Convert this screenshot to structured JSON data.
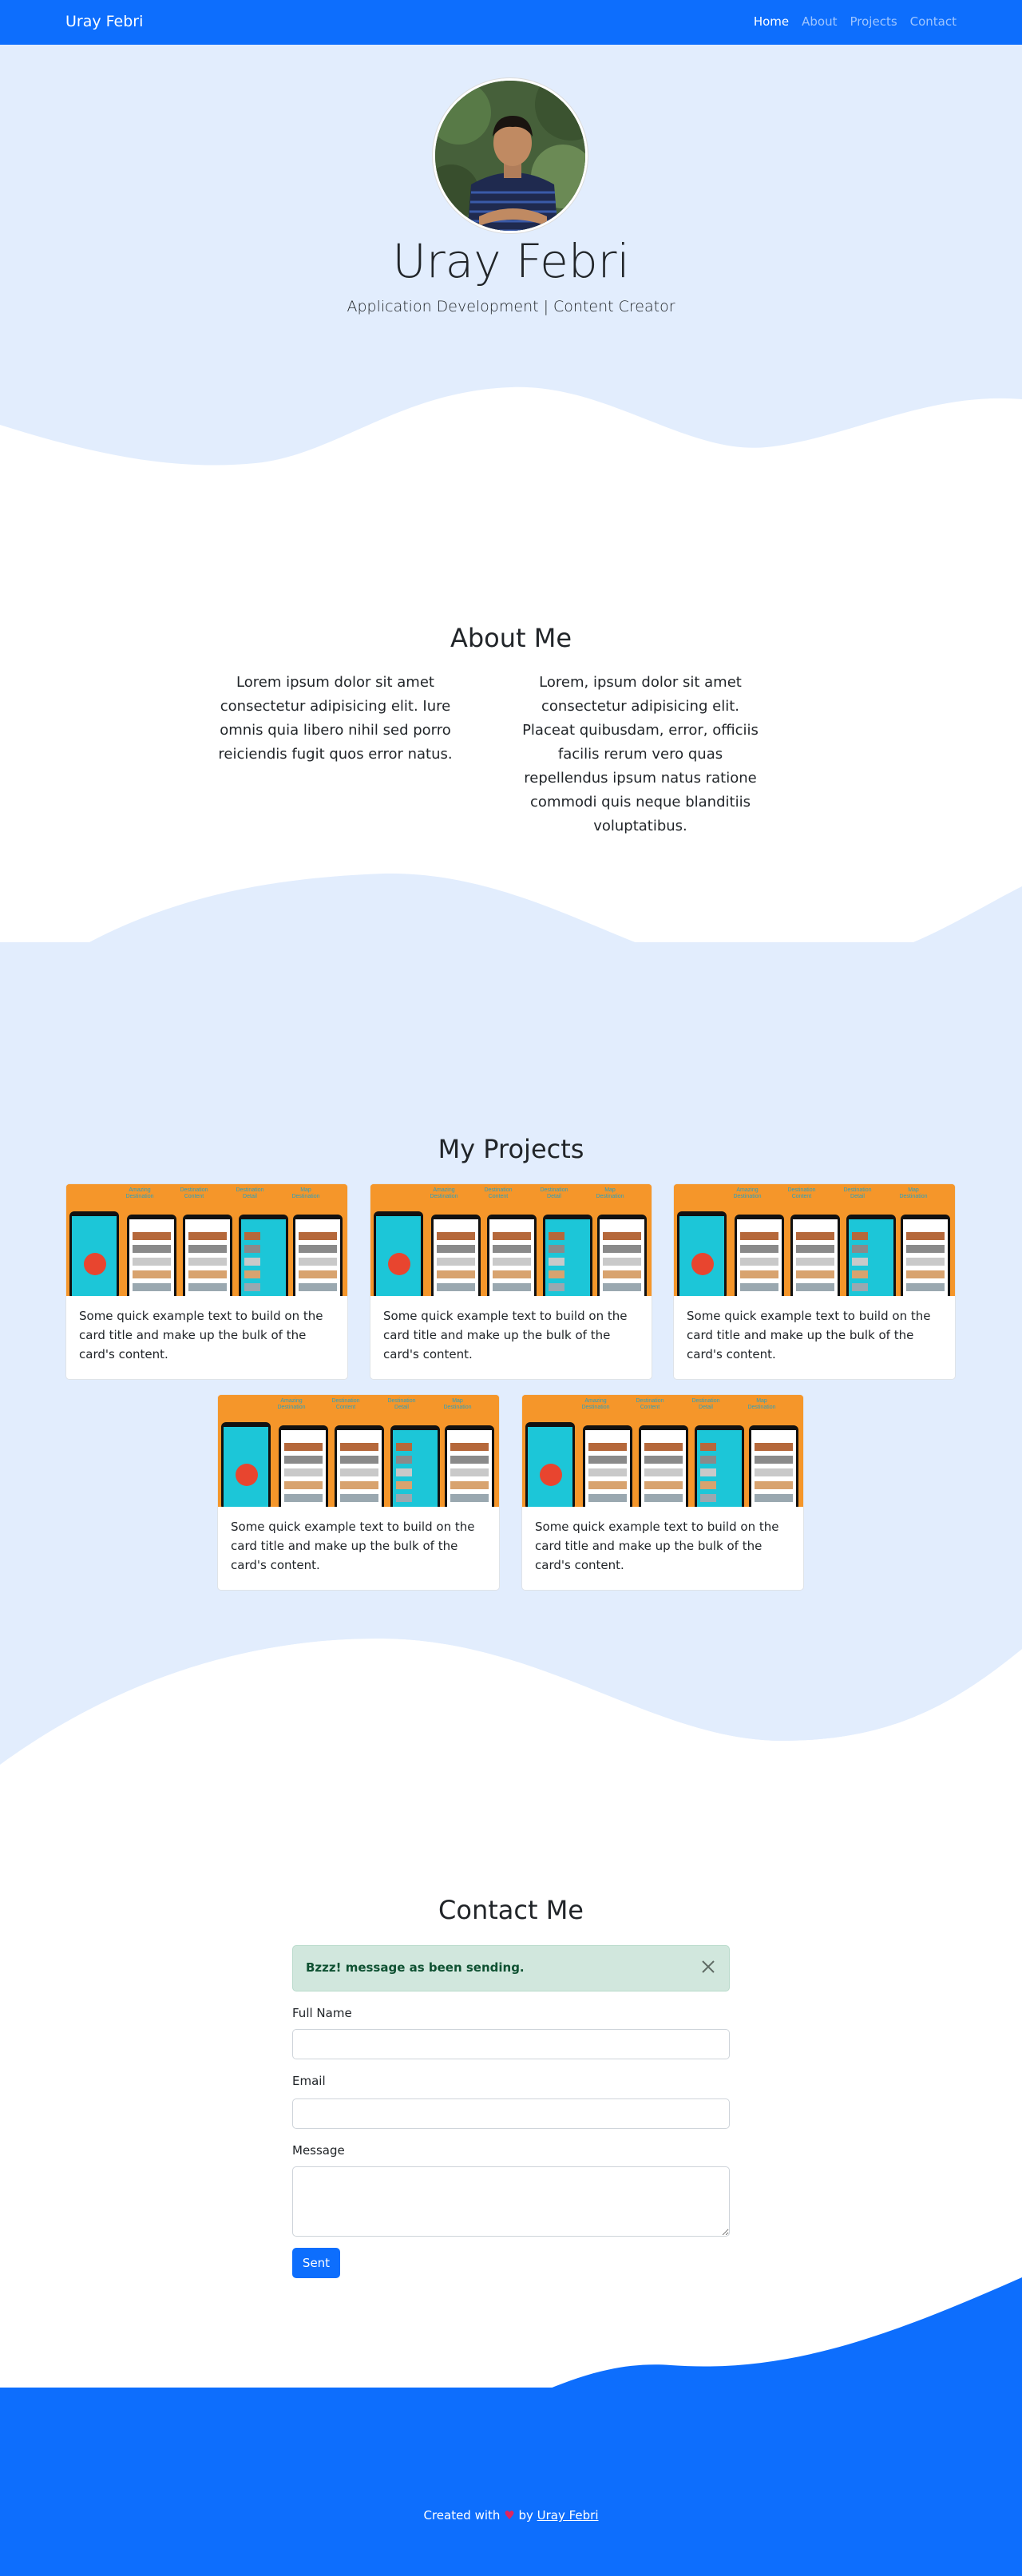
{
  "nav": {
    "brand": "Uray Febri",
    "links": [
      "Home",
      "About",
      "Projects",
      "Contact"
    ]
  },
  "hero": {
    "name": "Uray Febri",
    "subtitle": "Application Development | Content Creator"
  },
  "about": {
    "title": "About Me",
    "col1": "Lorem ipsum dolor sit amet consectetur adipisicing elit. Iure omnis quia libero nihil sed porro reiciendis fugit quos error natus.",
    "col2": "Lorem, ipsum dolor sit amet consectetur adipisicing elit. Placeat quibusdam, error, officiis facilis rerum vero quas repellendus ipsum natus ratione commodi quis neque blanditiis voluptatibus."
  },
  "projects": {
    "title": "My Projects",
    "image_labels": [
      "Amazing Destination",
      "Destination Content",
      "Destination Detail",
      "Map Destination"
    ],
    "cards": [
      {
        "text": "Some quick example text to build on the card title and make up the bulk of the card's content."
      },
      {
        "text": "Some quick example text to build on the card title and make up the bulk of the card's content."
      },
      {
        "text": "Some quick example text to build on the card title and make up the bulk of the card's content."
      },
      {
        "text": "Some quick example text to build on the card title and make up the bulk of the card's content."
      },
      {
        "text": "Some quick example text to build on the card title and make up the bulk of the card's content."
      }
    ]
  },
  "contact": {
    "title": "Contact Me",
    "alert": "Bzzz! message as been sending.",
    "full_name_label": "Full Name",
    "email_label": "Email",
    "message_label": "Message",
    "full_name_value": "",
    "email_value": "",
    "message_value": "",
    "submit_label": "Sent"
  },
  "footer": {
    "prefix": "Created with",
    "by": "by",
    "author": "Uray Febri"
  },
  "colors": {
    "primary": "#0d6efd",
    "light_blue": "#e2edfd",
    "alert_bg": "#d1e7dd",
    "alert_text": "#0f5132"
  }
}
